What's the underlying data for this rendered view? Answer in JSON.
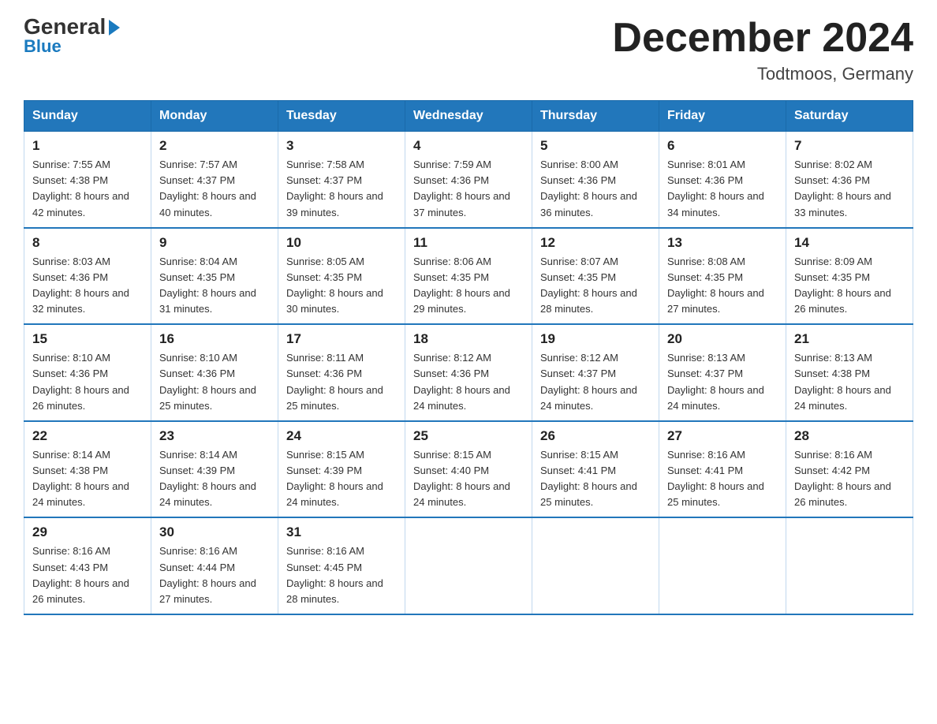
{
  "header": {
    "logo_general": "General",
    "logo_blue": "Blue",
    "month_title": "December 2024",
    "location": "Todtmoos, Germany"
  },
  "days_of_week": [
    "Sunday",
    "Monday",
    "Tuesday",
    "Wednesday",
    "Thursday",
    "Friday",
    "Saturday"
  ],
  "weeks": [
    [
      {
        "day": "1",
        "sunrise": "7:55 AM",
        "sunset": "4:38 PM",
        "daylight": "8 hours and 42 minutes."
      },
      {
        "day": "2",
        "sunrise": "7:57 AM",
        "sunset": "4:37 PM",
        "daylight": "8 hours and 40 minutes."
      },
      {
        "day": "3",
        "sunrise": "7:58 AM",
        "sunset": "4:37 PM",
        "daylight": "8 hours and 39 minutes."
      },
      {
        "day": "4",
        "sunrise": "7:59 AM",
        "sunset": "4:36 PM",
        "daylight": "8 hours and 37 minutes."
      },
      {
        "day": "5",
        "sunrise": "8:00 AM",
        "sunset": "4:36 PM",
        "daylight": "8 hours and 36 minutes."
      },
      {
        "day": "6",
        "sunrise": "8:01 AM",
        "sunset": "4:36 PM",
        "daylight": "8 hours and 34 minutes."
      },
      {
        "day": "7",
        "sunrise": "8:02 AM",
        "sunset": "4:36 PM",
        "daylight": "8 hours and 33 minutes."
      }
    ],
    [
      {
        "day": "8",
        "sunrise": "8:03 AM",
        "sunset": "4:36 PM",
        "daylight": "8 hours and 32 minutes."
      },
      {
        "day": "9",
        "sunrise": "8:04 AM",
        "sunset": "4:35 PM",
        "daylight": "8 hours and 31 minutes."
      },
      {
        "day": "10",
        "sunrise": "8:05 AM",
        "sunset": "4:35 PM",
        "daylight": "8 hours and 30 minutes."
      },
      {
        "day": "11",
        "sunrise": "8:06 AM",
        "sunset": "4:35 PM",
        "daylight": "8 hours and 29 minutes."
      },
      {
        "day": "12",
        "sunrise": "8:07 AM",
        "sunset": "4:35 PM",
        "daylight": "8 hours and 28 minutes."
      },
      {
        "day": "13",
        "sunrise": "8:08 AM",
        "sunset": "4:35 PM",
        "daylight": "8 hours and 27 minutes."
      },
      {
        "day": "14",
        "sunrise": "8:09 AM",
        "sunset": "4:35 PM",
        "daylight": "8 hours and 26 minutes."
      }
    ],
    [
      {
        "day": "15",
        "sunrise": "8:10 AM",
        "sunset": "4:36 PM",
        "daylight": "8 hours and 26 minutes."
      },
      {
        "day": "16",
        "sunrise": "8:10 AM",
        "sunset": "4:36 PM",
        "daylight": "8 hours and 25 minutes."
      },
      {
        "day": "17",
        "sunrise": "8:11 AM",
        "sunset": "4:36 PM",
        "daylight": "8 hours and 25 minutes."
      },
      {
        "day": "18",
        "sunrise": "8:12 AM",
        "sunset": "4:36 PM",
        "daylight": "8 hours and 24 minutes."
      },
      {
        "day": "19",
        "sunrise": "8:12 AM",
        "sunset": "4:37 PM",
        "daylight": "8 hours and 24 minutes."
      },
      {
        "day": "20",
        "sunrise": "8:13 AM",
        "sunset": "4:37 PM",
        "daylight": "8 hours and 24 minutes."
      },
      {
        "day": "21",
        "sunrise": "8:13 AM",
        "sunset": "4:38 PM",
        "daylight": "8 hours and 24 minutes."
      }
    ],
    [
      {
        "day": "22",
        "sunrise": "8:14 AM",
        "sunset": "4:38 PM",
        "daylight": "8 hours and 24 minutes."
      },
      {
        "day": "23",
        "sunrise": "8:14 AM",
        "sunset": "4:39 PM",
        "daylight": "8 hours and 24 minutes."
      },
      {
        "day": "24",
        "sunrise": "8:15 AM",
        "sunset": "4:39 PM",
        "daylight": "8 hours and 24 minutes."
      },
      {
        "day": "25",
        "sunrise": "8:15 AM",
        "sunset": "4:40 PM",
        "daylight": "8 hours and 24 minutes."
      },
      {
        "day": "26",
        "sunrise": "8:15 AM",
        "sunset": "4:41 PM",
        "daylight": "8 hours and 25 minutes."
      },
      {
        "day": "27",
        "sunrise": "8:16 AM",
        "sunset": "4:41 PM",
        "daylight": "8 hours and 25 minutes."
      },
      {
        "day": "28",
        "sunrise": "8:16 AM",
        "sunset": "4:42 PM",
        "daylight": "8 hours and 26 minutes."
      }
    ],
    [
      {
        "day": "29",
        "sunrise": "8:16 AM",
        "sunset": "4:43 PM",
        "daylight": "8 hours and 26 minutes."
      },
      {
        "day": "30",
        "sunrise": "8:16 AM",
        "sunset": "4:44 PM",
        "daylight": "8 hours and 27 minutes."
      },
      {
        "day": "31",
        "sunrise": "8:16 AM",
        "sunset": "4:45 PM",
        "daylight": "8 hours and 28 minutes."
      },
      null,
      null,
      null,
      null
    ]
  ]
}
